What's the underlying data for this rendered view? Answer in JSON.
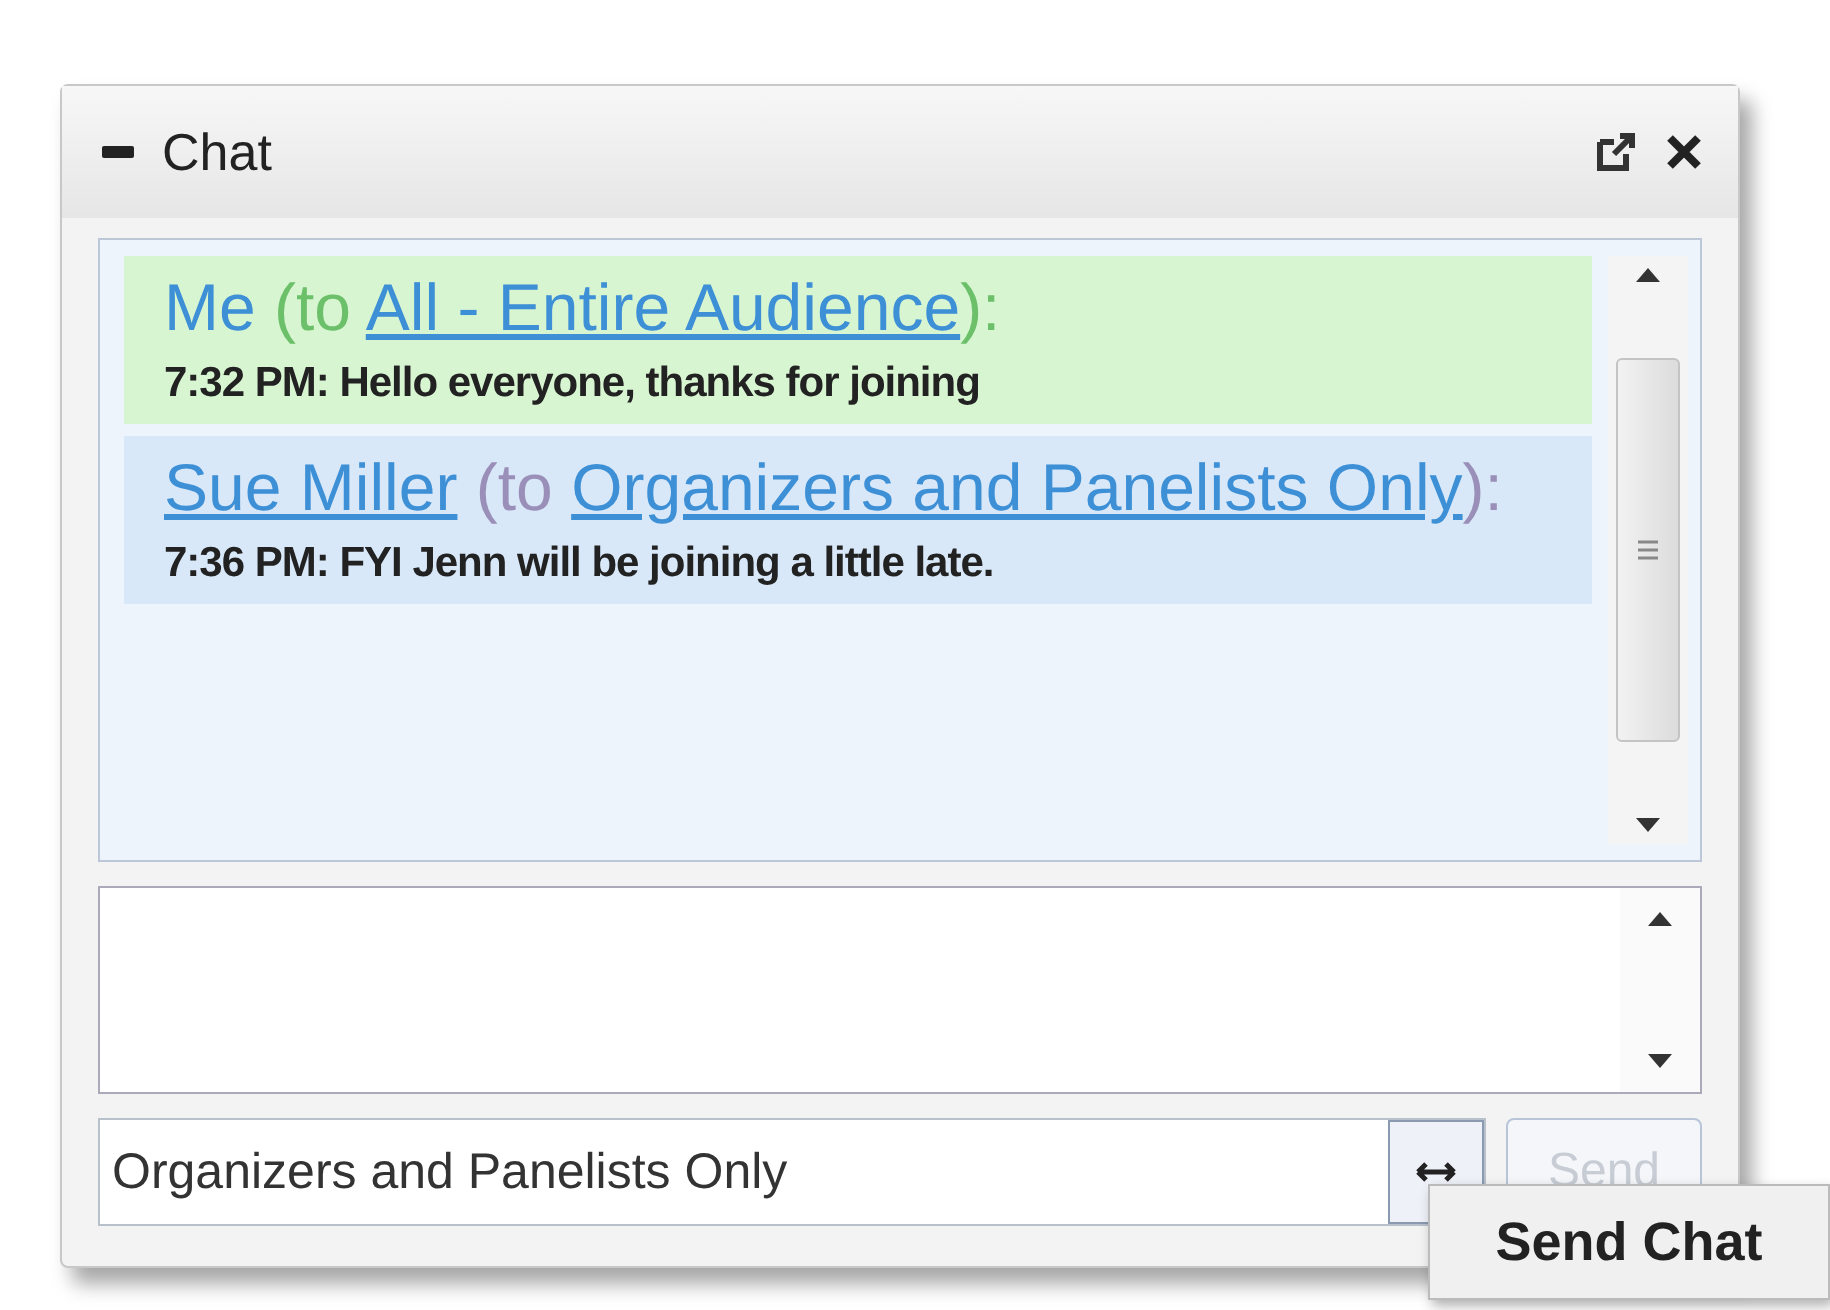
{
  "window": {
    "title": "Chat"
  },
  "messages": [
    {
      "kind": "self",
      "sender": "Me",
      "to_prefix": "(to",
      "recipient": "All - Entire Audience",
      "suffix": "):",
      "body": "7:32 PM: Hello everyone, thanks for joining"
    },
    {
      "kind": "other",
      "sender": "Sue Miller",
      "to_prefix": "(to",
      "recipient": "Organizers and Panelists Only",
      "suffix": "):",
      "body": "7:36 PM: FYI Jenn will be joining a little late."
    }
  ],
  "recipient_select": {
    "value": "Organizers and Panelists Only"
  },
  "send_button": {
    "label": "Send",
    "disabled": true
  },
  "tooltip": {
    "text": "Send Chat"
  }
}
